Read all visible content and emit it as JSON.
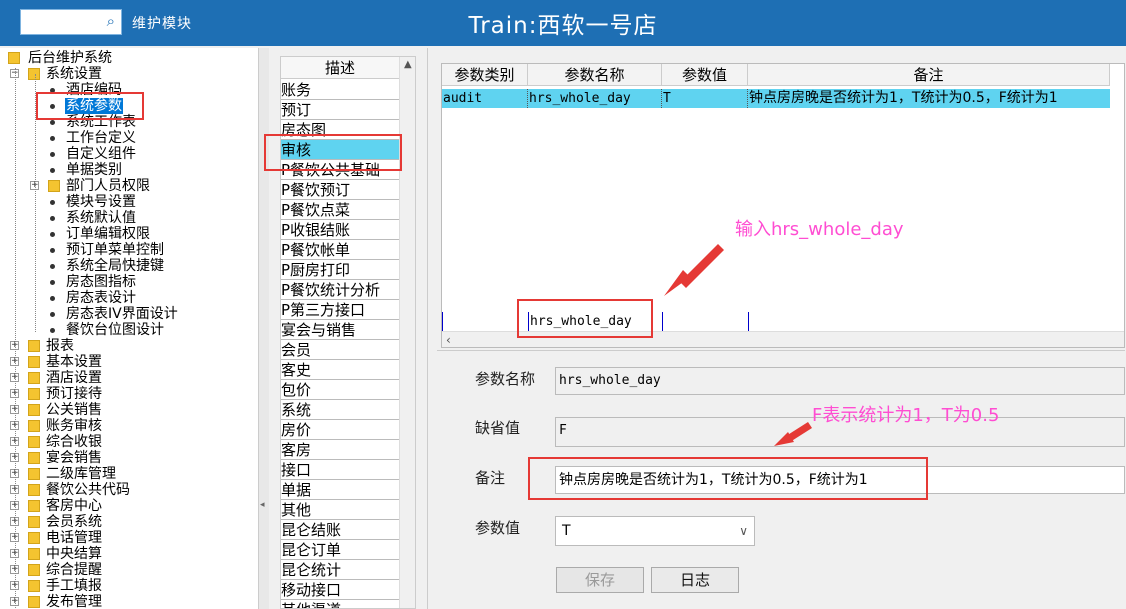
{
  "header": {
    "search_icon": "search-icon",
    "module_name": "维护模块",
    "title": "Train:西软一号店"
  },
  "tree": {
    "root": "后台维护系统",
    "items": [
      {
        "label": "系统设置",
        "level": 1,
        "type": "folder",
        "expander": "−"
      },
      {
        "label": "酒店编码",
        "level": 2,
        "type": "leaf"
      },
      {
        "label": "系统参数",
        "level": 2,
        "type": "leaf",
        "selected": true
      },
      {
        "label": "系统工作表",
        "level": 2,
        "type": "leaf"
      },
      {
        "label": "工作台定义",
        "level": 2,
        "type": "leaf"
      },
      {
        "label": "自定义组件",
        "level": 2,
        "type": "leaf"
      },
      {
        "label": "单据类别",
        "level": 2,
        "type": "leaf"
      },
      {
        "label": "部门人员权限",
        "level": 2,
        "type": "folder",
        "expander": "+"
      },
      {
        "label": "模块号设置",
        "level": 2,
        "type": "leaf"
      },
      {
        "label": "系统默认值",
        "level": 2,
        "type": "leaf"
      },
      {
        "label": "订单编辑权限",
        "level": 2,
        "type": "leaf"
      },
      {
        "label": "预订单菜单控制",
        "level": 2,
        "type": "leaf"
      },
      {
        "label": "系统全局快捷键",
        "level": 2,
        "type": "leaf"
      },
      {
        "label": "房态图指标",
        "level": 2,
        "type": "leaf"
      },
      {
        "label": "房态表设计",
        "level": 2,
        "type": "leaf"
      },
      {
        "label": "房态表IV界面设计",
        "level": 2,
        "type": "leaf"
      },
      {
        "label": "餐饮台位图设计",
        "level": 2,
        "type": "leaf"
      },
      {
        "label": "报表",
        "level": 1,
        "type": "folder",
        "expander": "+"
      },
      {
        "label": "基本设置",
        "level": 1,
        "type": "folder",
        "expander": "+"
      },
      {
        "label": "酒店设置",
        "level": 1,
        "type": "folder",
        "expander": "+"
      },
      {
        "label": "预订接待",
        "level": 1,
        "type": "folder",
        "expander": "+"
      },
      {
        "label": "公关销售",
        "level": 1,
        "type": "folder",
        "expander": "+"
      },
      {
        "label": "账务审核",
        "level": 1,
        "type": "folder",
        "expander": "+"
      },
      {
        "label": "综合收银",
        "level": 1,
        "type": "folder",
        "expander": "+"
      },
      {
        "label": "宴会销售",
        "level": 1,
        "type": "folder",
        "expander": "+"
      },
      {
        "label": "二级库管理",
        "level": 1,
        "type": "folder",
        "expander": "+"
      },
      {
        "label": "餐饮公共代码",
        "level": 1,
        "type": "folder",
        "expander": "+"
      },
      {
        "label": "客房中心",
        "level": 1,
        "type": "folder",
        "expander": "+"
      },
      {
        "label": "会员系统",
        "level": 1,
        "type": "folder",
        "expander": "+"
      },
      {
        "label": "电话管理",
        "level": 1,
        "type": "folder",
        "expander": "+"
      },
      {
        "label": "中央结算",
        "level": 1,
        "type": "folder",
        "expander": "+"
      },
      {
        "label": "综合提醒",
        "level": 1,
        "type": "folder",
        "expander": "+"
      },
      {
        "label": "手工填报",
        "level": 1,
        "type": "folder",
        "expander": "+"
      },
      {
        "label": "发布管理",
        "level": 1,
        "type": "folder",
        "expander": "+"
      }
    ]
  },
  "desc_list": {
    "header": "描述",
    "items": [
      "账务",
      "预订",
      "房态图",
      "审核",
      "P餐饮公共基础",
      "P餐饮预订",
      "P餐饮点菜",
      "P收银结账",
      "P餐饮帐单",
      "P厨房打印",
      "P餐饮统计分析",
      "P第三方接口",
      "宴会与销售",
      "会员",
      "客史",
      "包价",
      "系统",
      "房价",
      "客房",
      "接口",
      "单据",
      "其他",
      "昆仑结账",
      "昆仑订单",
      "昆仑统计",
      "移动接口",
      "其他渠道"
    ],
    "selected_index": 3
  },
  "grid": {
    "columns": [
      "参数类别",
      "参数名称",
      "参数值",
      "备注"
    ],
    "rows": [
      {
        "cat": "audit",
        "name": "hrs_whole_day",
        "value": "T",
        "remark": "钟点房房晚是否统计为1，T统计为0.5，F统计为1"
      }
    ],
    "edit_row_name": "hrs_whole_day"
  },
  "form": {
    "name_label": "参数名称",
    "name_value": "hrs_whole_day",
    "default_label": "缺省值",
    "default_value": "F",
    "remark_label": "备注",
    "remark_value": "钟点房房晚是否统计为1，T统计为0.5，F统计为1",
    "value_label": "参数值",
    "value_selected": "T",
    "save_label": "保存",
    "log_label": "日志"
  },
  "annotations": {
    "input_hint": "输入hrs_whole_day",
    "value_hint": "F表示统计为1，T为0.5"
  },
  "colors": {
    "header_bg": "#1e6fb4",
    "selection": "#0078d7",
    "row_highlight": "#5fd3f0",
    "annotation": "#ff4dd2",
    "annotation_box": "#e53935"
  }
}
